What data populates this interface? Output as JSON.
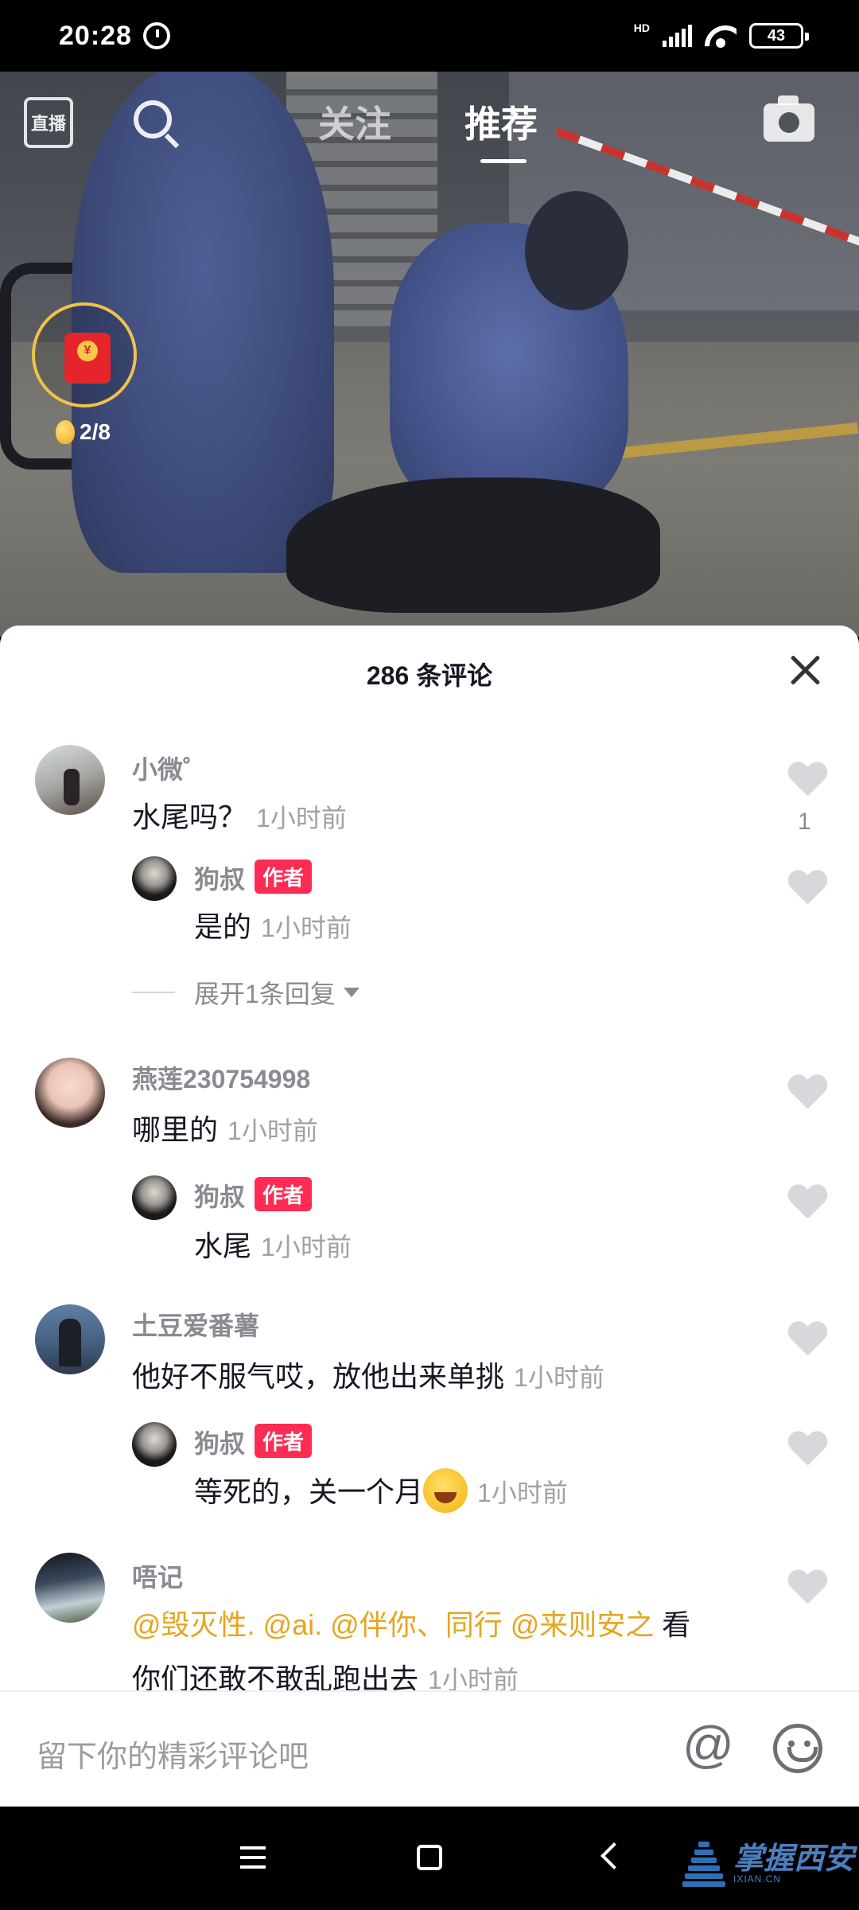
{
  "status_bar": {
    "time": "20:28",
    "network": "HD",
    "battery": "43"
  },
  "top_nav": {
    "live_label": "直播",
    "tab_follow": "关注",
    "tab_recommend": "推荐",
    "active_tab": "推荐"
  },
  "red_packet": {
    "progress_text": "2/8",
    "coin_symbol": "¥"
  },
  "comments_panel": {
    "title": "286 条评论",
    "comments": [
      {
        "username": "小微゜",
        "text": "水尾吗？",
        "time": "1小时前",
        "likes": "1",
        "reply": {
          "username": "狗叔",
          "badge": "作者",
          "text": "是的",
          "time": "1小时前"
        },
        "expand_label": "展开1条回复"
      },
      {
        "username": "燕莲230754998",
        "text": "哪里的",
        "time": "1小时前",
        "reply": {
          "username": "狗叔",
          "badge": "作者",
          "text": "水尾",
          "time": "1小时前"
        }
      },
      {
        "username": "土豆爱番薯",
        "text": "他好不服气哎，放他出来单挑",
        "time": "1小时前",
        "reply": {
          "username": "狗叔",
          "badge": "作者",
          "text": "等死的，关一个月",
          "time": "1小时前"
        }
      },
      {
        "username": "唔记",
        "mentions": [
          "@毁灭性.",
          "@ai.",
          "@伴你、同行",
          "@来则安之"
        ],
        "text_line1_tail": "看",
        "text_line2": "你们还敢不敢乱跑出去",
        "time": "1小时前"
      }
    ]
  },
  "input_bar": {
    "placeholder": "留下你的精彩评论吧",
    "at_symbol": "@"
  },
  "watermark": {
    "text": "掌握西安",
    "url": "IXIAN.CN"
  },
  "colors": {
    "author_badge": "#fe2c55",
    "mention": "#e6a51f",
    "text_primary": "#161823",
    "text_secondary": "#8a8b91"
  }
}
